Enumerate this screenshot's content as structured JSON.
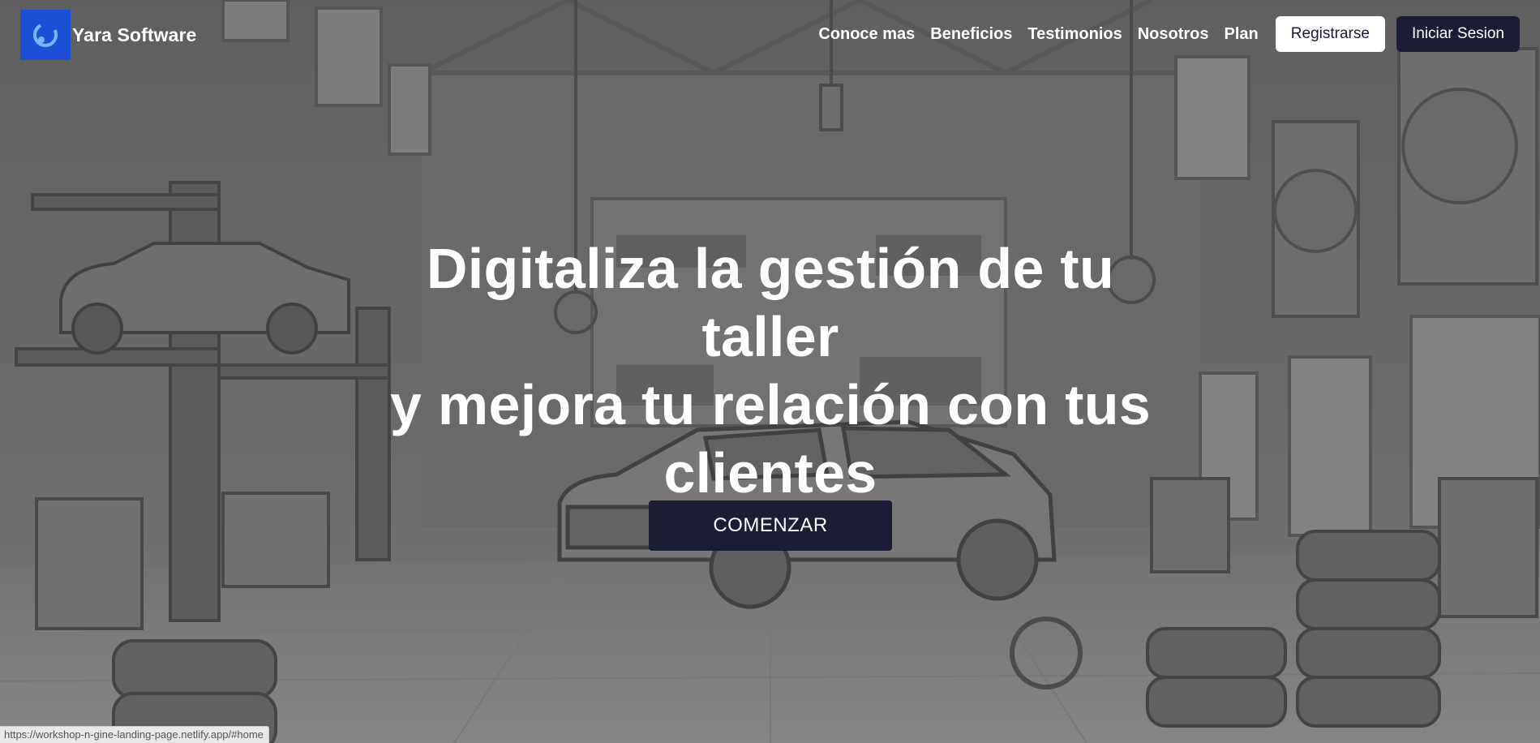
{
  "brand": {
    "name": "Yara Software",
    "icon": "yara-logo-icon",
    "color": "#1d4fd6"
  },
  "nav": {
    "links": [
      "Conoce mas",
      "Beneficios",
      "Testimonios",
      "Nosotros",
      "Plan"
    ],
    "register_label": "Registrarse",
    "login_label": "Iniciar Sesion"
  },
  "hero": {
    "title_lines": [
      "Digitaliza la gestión de tu taller",
      "y mejora tu relación con tus",
      "clientes"
    ],
    "cta_label": "COMENZAR",
    "background": "grayscale-car-workshop-image"
  },
  "status_bar": {
    "url": "https://workshop-n-gine-landing-page.netlify.app/#home"
  },
  "colors": {
    "accent_dark": "#1b1d36",
    "white": "#ffffff"
  }
}
